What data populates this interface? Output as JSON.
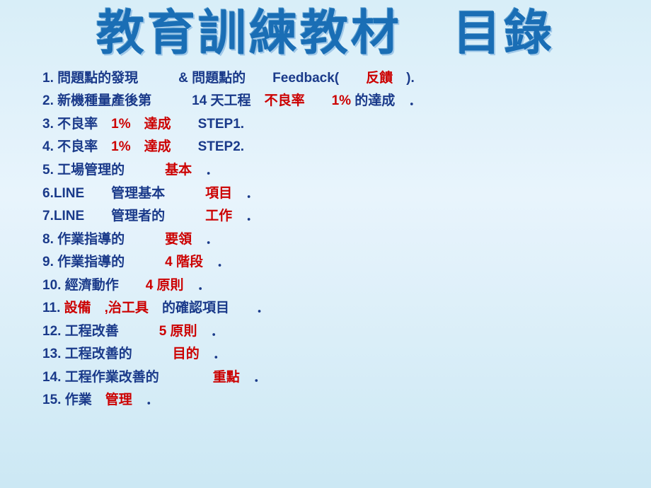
{
  "title": "教育訓練教材　目錄",
  "items": [
    {
      "num": "1.",
      "text1": " 問題點的發現　　　& 問題點的　　",
      "highlight": "Feedback(　　",
      "red": "反饋",
      "text2": "　)."
    },
    {
      "num": "2.",
      "text1": " 新機種量產後第　　　14 天工程　",
      "red": "不良率　　1%",
      "text2": " 的達成　．"
    },
    {
      "num": "3.",
      "text1": " 不良率　",
      "red": "1%　達成",
      "text2": "　　STEP1."
    },
    {
      "num": "4.",
      "text1": " 不良率　",
      "red": "1%　達成",
      "text2": "　　STEP2."
    },
    {
      "num": "5.",
      "text1": " 工場管理的　　　",
      "red": "基本",
      "text2": "　．"
    },
    {
      "num": "6.",
      "text1": "LINE　　管理基本　　　",
      "red": "項目",
      "text2": "　．"
    },
    {
      "num": "7.",
      "text1": "LINE　　管理者的　　　",
      "red": "工作",
      "text2": "　．"
    },
    {
      "num": "8.",
      "text1": " 作業指導的　　　",
      "red": "要領",
      "text2": "　．"
    },
    {
      "num": "9.",
      "text1": " 作業指導的　　　",
      "red": "4 階段",
      "text2": "　．"
    },
    {
      "num": "10.",
      "text1": " 經濟動作　　",
      "red": "4 原則",
      "text2": "　．"
    },
    {
      "num": "11.",
      "text1": "  ",
      "red": "設備　,治工具",
      "text2": "　的確認項目　　．"
    },
    {
      "num": "12.",
      "text1": " 工程改善　　　",
      "red": "5 原則",
      "text2": "　．"
    },
    {
      "num": "13.",
      "text1": " 工程改善的　　　",
      "red": "目的",
      "text2": "　．"
    },
    {
      "num": "14.",
      "text1": " 工程作業改善的　　　　",
      "red": "重點",
      "text2": "　．"
    },
    {
      "num": "15.",
      "text1": " 作業　",
      "red": "管理",
      "text2": "　．"
    }
  ]
}
